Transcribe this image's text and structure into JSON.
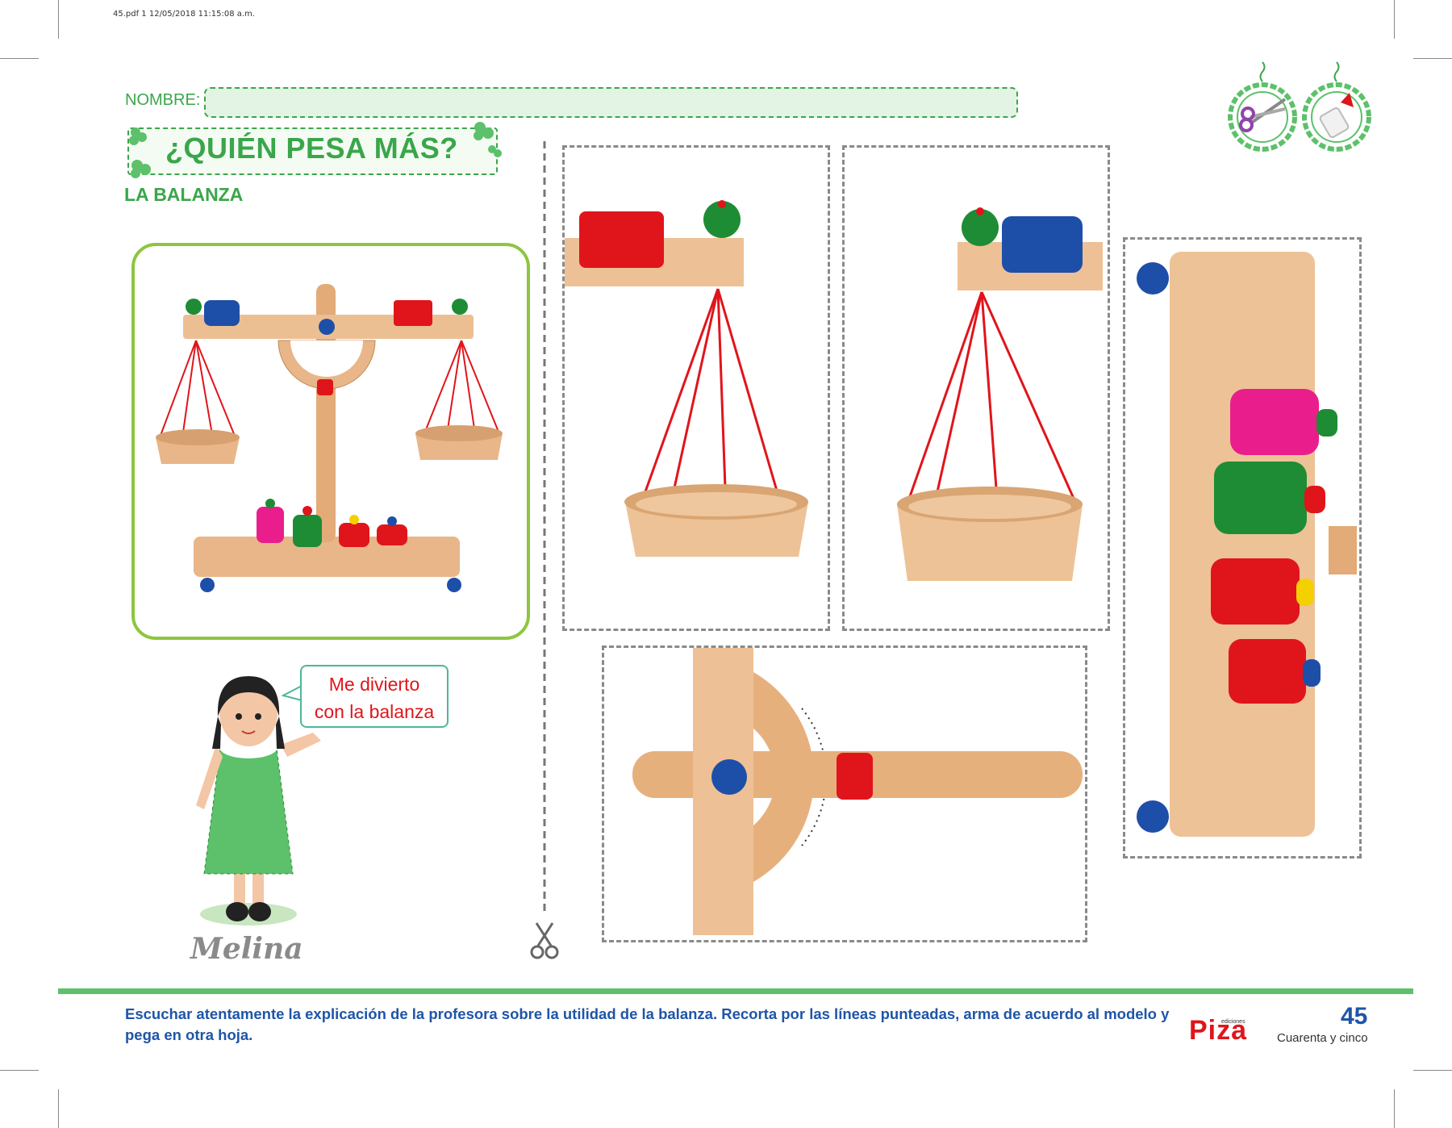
{
  "print_info": "45.pdf   1   12/05/2018   11:15:08 a.m.",
  "worksheet": {
    "name_label": "NOMBRE:",
    "title": "¿QUIÉN PESA MÁS?",
    "subtitle": "LA BALANZA"
  },
  "tools": {
    "icons": [
      "scissors-icon",
      "glue-icon"
    ]
  },
  "character": {
    "speech": [
      "Me divierto",
      "con la balanza"
    ],
    "name": "Melina"
  },
  "footer": {
    "instructions": "Escuchar atentamente la explicación de la profesora sobre la utilidad de la balanza. Recorta por las líneas punteadas, arma de acuerdo al modelo y pega en otra hoja.",
    "publisher_small": "ediciones",
    "publisher": "Piza",
    "page_number": "45",
    "page_words": "Cuarenta y cinco"
  },
  "colors": {
    "green": "#3aa64a",
    "lime": "#8dc63f",
    "blue_text": "#1e55a8",
    "red": "#e0151b",
    "wood": "#e9b98a",
    "string": "#e0151b"
  }
}
